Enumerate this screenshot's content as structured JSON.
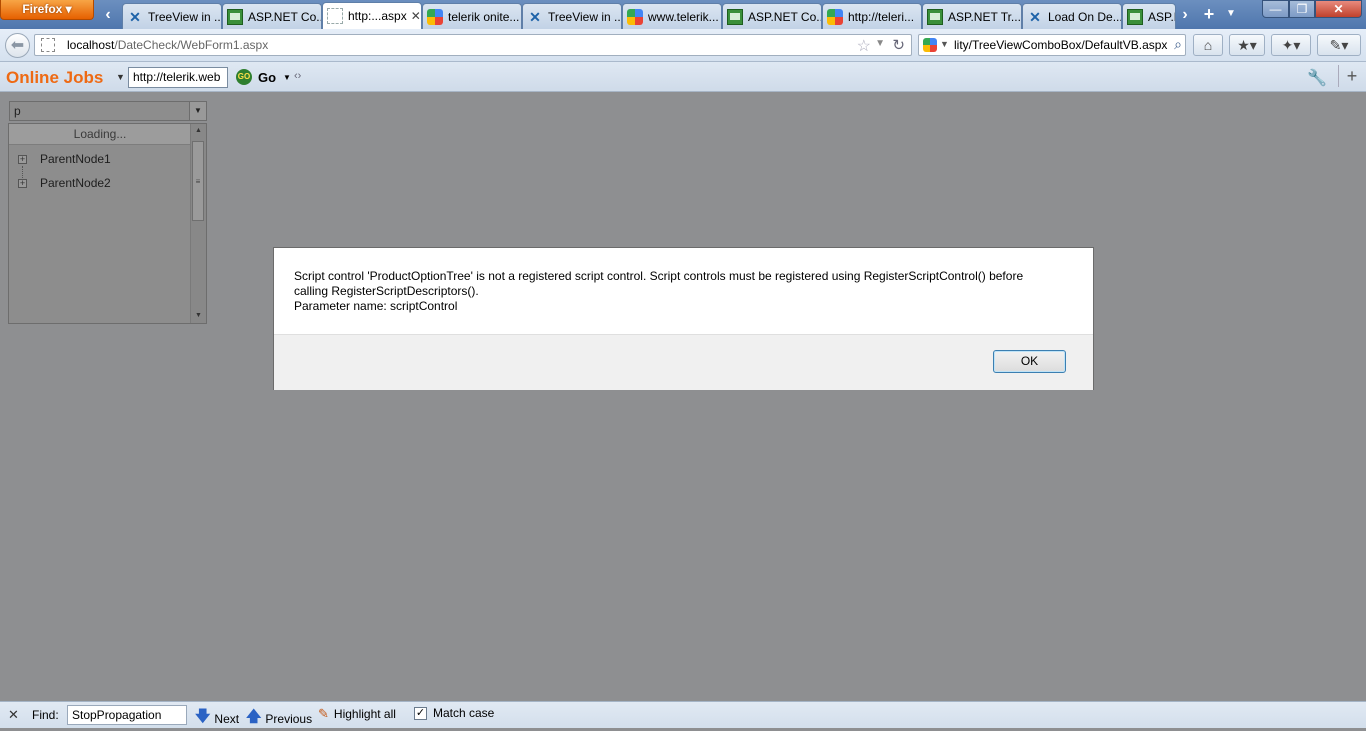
{
  "browser": {
    "menu_button": "Firefox",
    "tabs": [
      {
        "label": "TreeView in ...",
        "icon": "telerik-icon"
      },
      {
        "label": "ASP.NET Co...",
        "icon": "asp-net-icon"
      },
      {
        "label": "http:...aspx",
        "icon": "blank-page-icon",
        "active": true
      },
      {
        "label": "telerik onite...",
        "icon": "google-icon"
      },
      {
        "label": "TreeView in ...",
        "icon": "telerik-icon"
      },
      {
        "label": "www.telerik...",
        "icon": "google-icon"
      },
      {
        "label": "ASP.NET Co...",
        "icon": "asp-net-icon"
      },
      {
        "label": "http://teleri...",
        "icon": "google-icon"
      },
      {
        "label": "ASP.NET Tr...",
        "icon": "asp-net-icon"
      },
      {
        "label": "Load On De...",
        "icon": "telerik-icon"
      },
      {
        "label": "ASP.N",
        "icon": "asp-net-icon"
      }
    ],
    "url_host": "localhost",
    "url_path": "/DateCheck/WebForm1.aspx",
    "search_text": "lity/TreeViewComboBox/DefaultVB.aspx"
  },
  "toolbar": {
    "brand": "Online Jobs",
    "input_value": "http://telerik.web",
    "go_label": "Go",
    "go_icon_text": "GO"
  },
  "combo": {
    "input_value": "p",
    "loading_text": "Loading...",
    "nodes": [
      "ParentNode1",
      "ParentNode2"
    ]
  },
  "dialog": {
    "line1": "Script control 'ProductOptionTree' is not a registered script control. Script controls must be registered using RegisterScriptControl() before",
    "line2": "calling RegisterScriptDescriptors().",
    "line3": "Parameter name: scriptControl",
    "ok_label": "OK"
  },
  "findbar": {
    "label": "Find:",
    "query": "StopPropagation",
    "next": "Next",
    "previous": "Previous",
    "highlight_all": "Highlight all",
    "match_case": "Match case",
    "match_case_checked": true
  },
  "colors": {
    "brand": "#ee6a14",
    "firefox_button": "#e66000",
    "page_overlay": "#8e8f91"
  }
}
